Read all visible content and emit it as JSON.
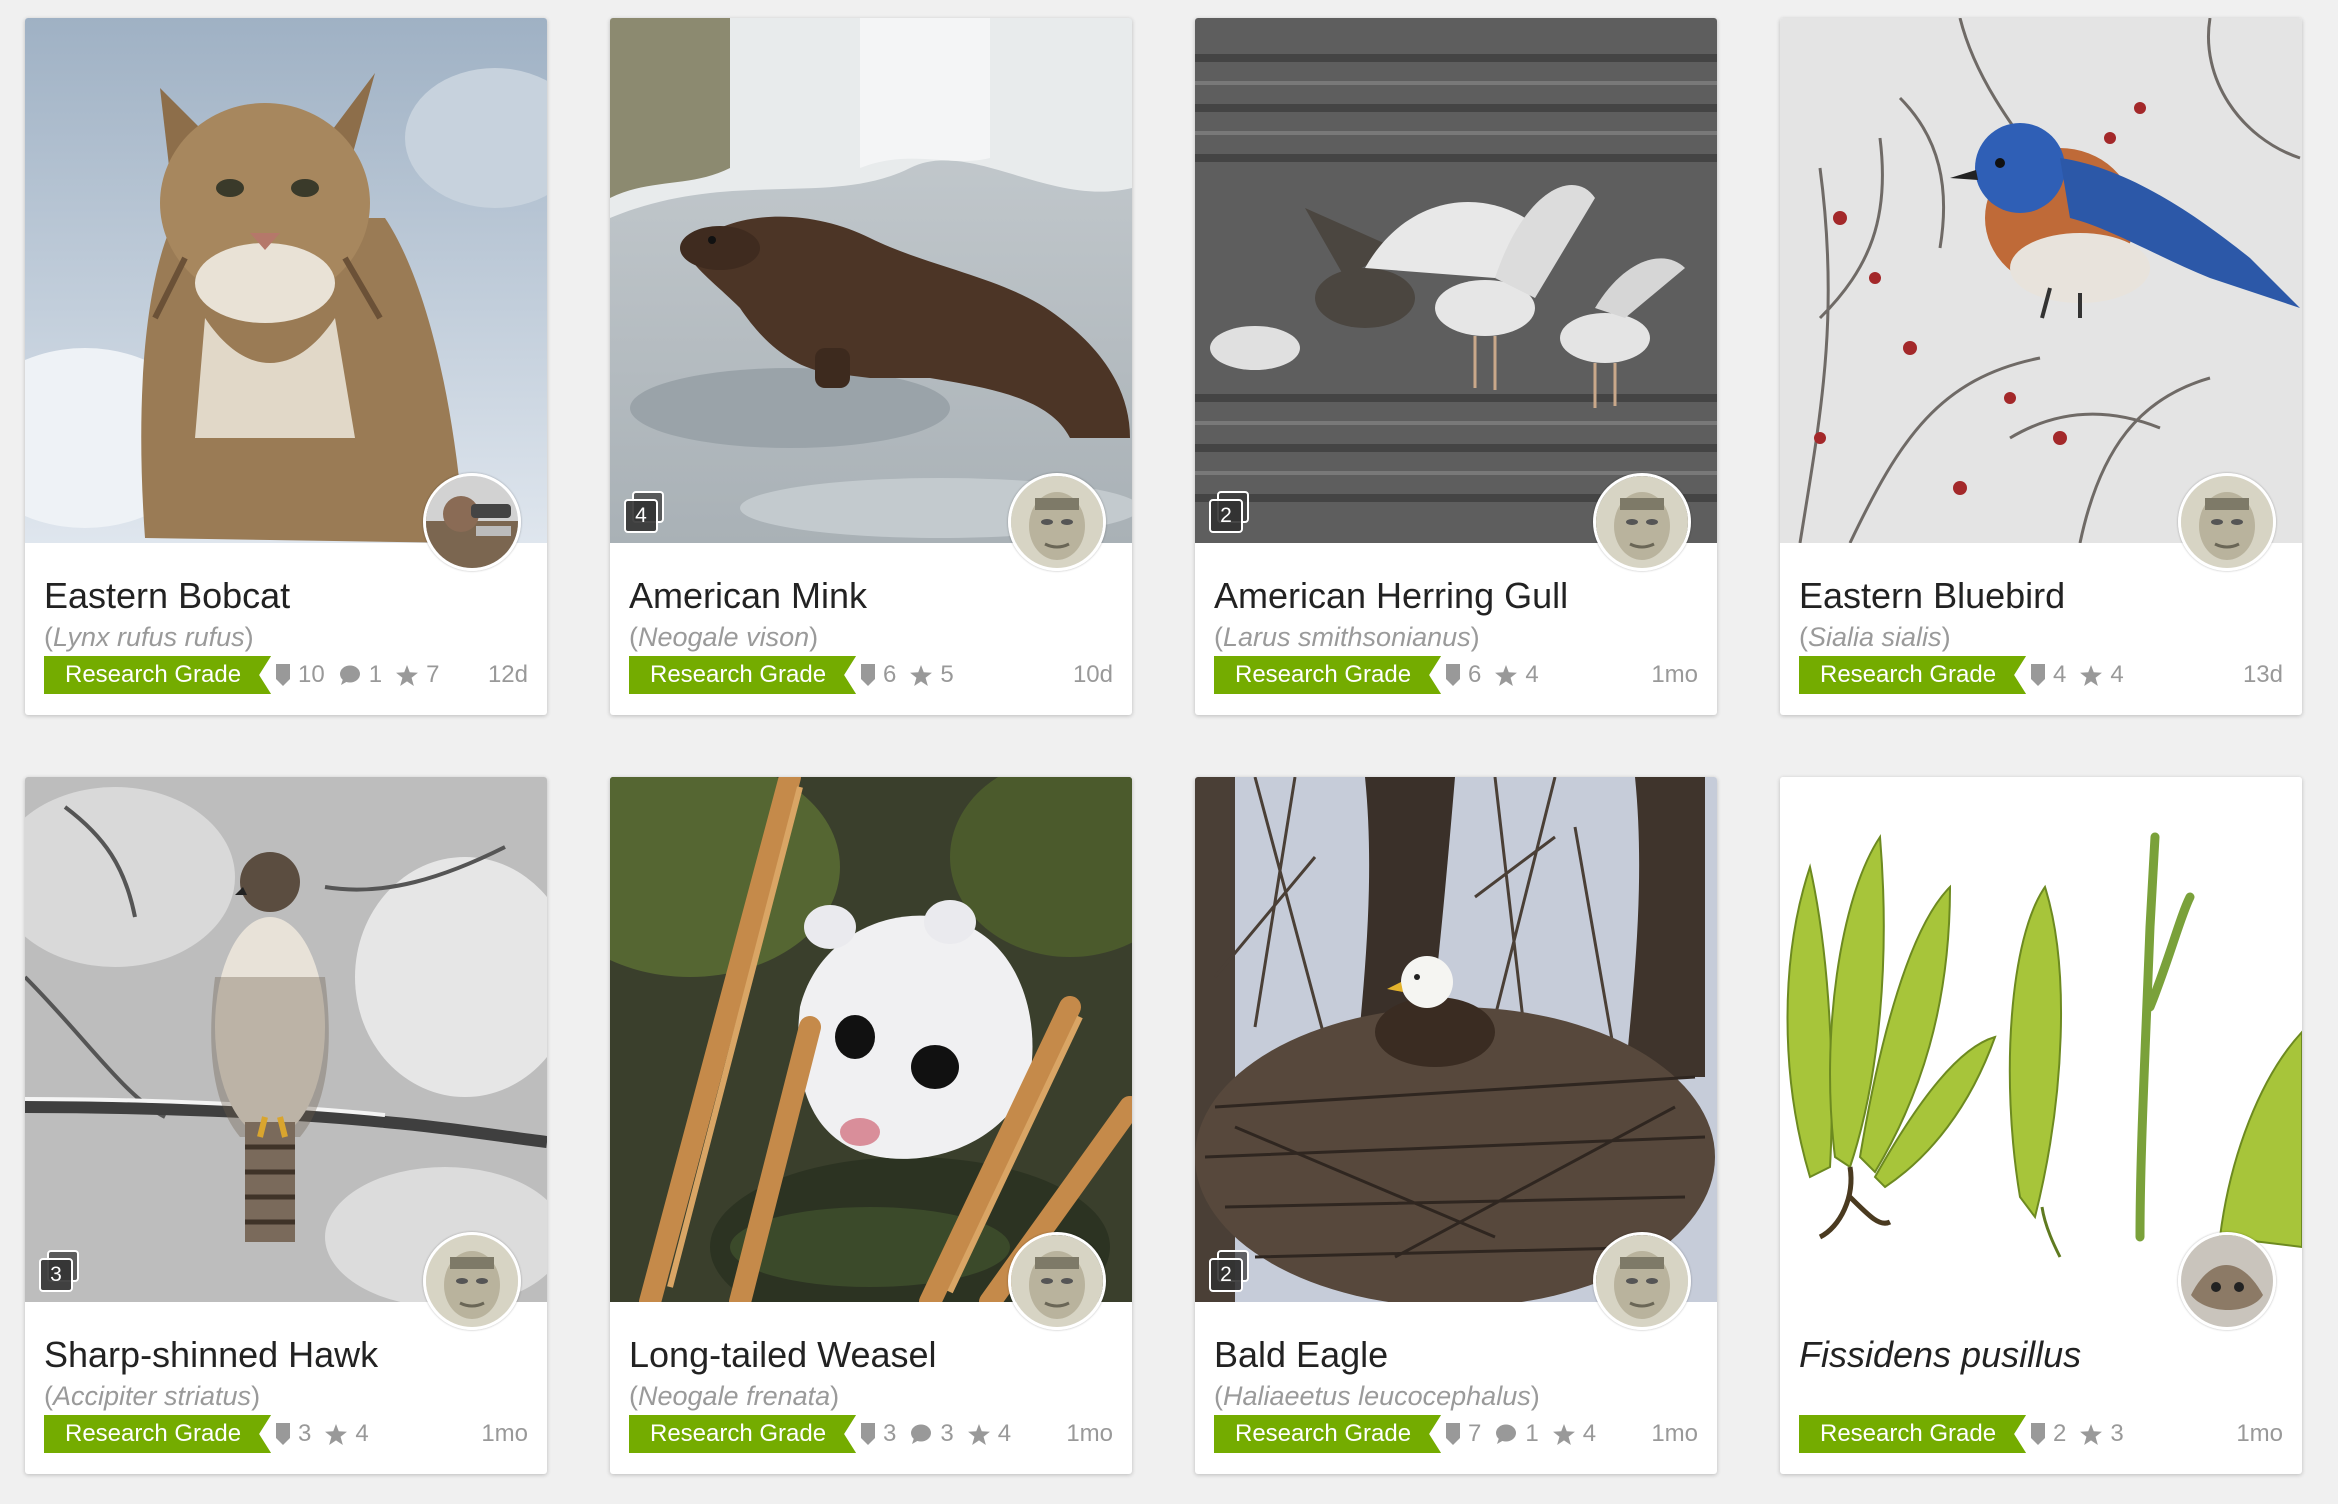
{
  "cards": [
    {
      "common_name": "Eastern Bobcat",
      "scientific_name": "Lynx rufus rufus",
      "quality": "Research Grade",
      "identifications": "10",
      "comments": "1",
      "faves": "7",
      "age": "12d",
      "photo_count": "",
      "photo_colors": [
        "#b6c3d0",
        "#8a7150",
        "#ccd5de"
      ],
      "avatar_colors": [
        "#8a6b55",
        "#d2d2d2"
      ]
    },
    {
      "common_name": "American Mink",
      "scientific_name": "Neogale vison",
      "quality": "Research Grade",
      "identifications": "6",
      "comments": "",
      "faves": "5",
      "age": "10d",
      "photo_count": "4",
      "photo_colors": [
        "#d8dde0",
        "#4c3526",
        "#b8bfc4"
      ],
      "avatar_colors": [
        "#d7d4c4",
        "#9c9887"
      ]
    },
    {
      "common_name": "American Herring Gull",
      "scientific_name": "Larus smithsonianus",
      "quality": "Research Grade",
      "identifications": "6",
      "comments": "",
      "faves": "4",
      "age": "1mo",
      "photo_count": "2",
      "photo_colors": [
        "#707070",
        "#e3e3e3",
        "#3d3d3d"
      ],
      "avatar_colors": [
        "#d7d4c4",
        "#9c9887"
      ]
    },
    {
      "common_name": "Eastern Bluebird",
      "scientific_name": "Sialia sialis",
      "quality": "Research Grade",
      "identifications": "4",
      "comments": "",
      "faves": "4",
      "age": "13d",
      "photo_count": "",
      "photo_colors": [
        "#e6e6e6",
        "#2f5fb6",
        "#b8683c"
      ],
      "avatar_colors": [
        "#d7d4c4",
        "#9c9887"
      ]
    },
    {
      "common_name": "Sharp-shinned Hawk",
      "scientific_name": "Accipiter striatus",
      "quality": "Research Grade",
      "identifications": "3",
      "comments": "",
      "faves": "4",
      "age": "1mo",
      "photo_count": "3",
      "photo_colors": [
        "#cfcfcf",
        "#6b5b4b",
        "#ededed"
      ],
      "avatar_colors": [
        "#d7d4c4",
        "#9c9887"
      ]
    },
    {
      "common_name": "Long-tailed Weasel",
      "scientific_name": "Neogale frenata",
      "quality": "Research Grade",
      "identifications": "3",
      "comments": "3",
      "faves": "4",
      "age": "1mo",
      "photo_count": "",
      "photo_colors": [
        "#3e4a2a",
        "#f2f2f4",
        "#c58a4a"
      ],
      "avatar_colors": [
        "#d7d4c4",
        "#9c9887"
      ]
    },
    {
      "common_name": "Bald Eagle",
      "scientific_name": "Haliaeetus leucocephalus",
      "quality": "Research Grade",
      "identifications": "7",
      "comments": "1",
      "faves": "4",
      "age": "1mo",
      "photo_count": "2",
      "photo_colors": [
        "#c9cfdc",
        "#3a3029",
        "#57483c"
      ],
      "avatar_colors": [
        "#d7d4c4",
        "#9c9887"
      ]
    },
    {
      "common_name": "Fissidens pusillus",
      "scientific_name": "",
      "quality": "Research Grade",
      "identifications": "2",
      "comments": "",
      "faves": "3",
      "age": "1mo",
      "photo_count": "",
      "photo_colors": [
        "#ffffff",
        "#a7c53a",
        "#5f7a20"
      ],
      "avatar_colors": [
        "#8c7a66",
        "#c9c4bc"
      ]
    }
  ],
  "icons": {
    "identifications": "identification-shield-icon",
    "comments": "comment-bubble-icon",
    "faves": "star-icon"
  },
  "colors": {
    "badge": "#74ac00",
    "meta_text": "#999999",
    "background": "#f0f0f0"
  }
}
